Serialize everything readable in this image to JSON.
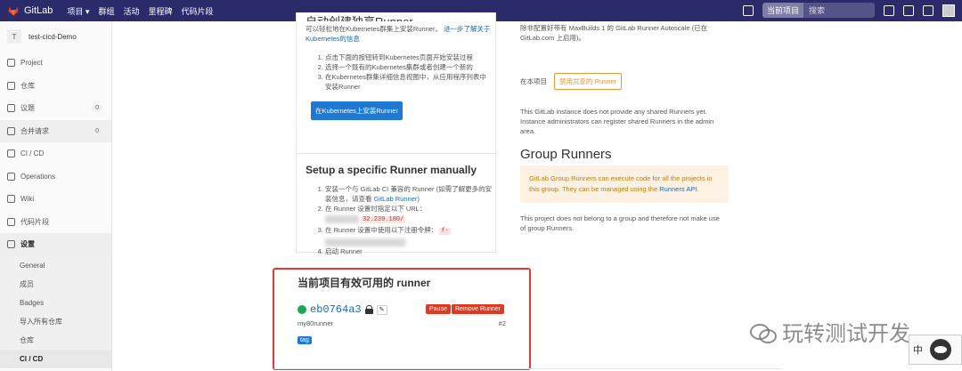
{
  "topbar": {
    "logo_text": "GitLab",
    "nav": [
      "项目 ▾",
      "群组",
      "活动",
      "里程碑",
      "代码片段"
    ],
    "search_scope": "当前项目",
    "search_placeholder": "搜索",
    "bg_color": "#2b2a6b"
  },
  "sidebar": {
    "project_initial": "T",
    "project_name": "test-cicd-Demo",
    "items": [
      {
        "label": "Project",
        "icon": "home-icon"
      },
      {
        "label": "仓库",
        "icon": "book-icon"
      },
      {
        "label": "议题",
        "icon": "issues-icon",
        "count": "0"
      },
      {
        "label": "合并请求",
        "icon": "merge-request-icon",
        "count": "0"
      },
      {
        "label": "CI / CD",
        "icon": "rocket-icon"
      },
      {
        "label": "Operations",
        "icon": "cloud-icon"
      },
      {
        "label": "Wiki",
        "icon": "book-open-icon"
      },
      {
        "label": "代码片段",
        "icon": "scissors-icon"
      }
    ],
    "settings_label": "设置",
    "settings_subitems": [
      "General",
      "成员",
      "Badges",
      "导入所有仓库",
      "仓库",
      "CI / CD"
    ]
  },
  "specific": {
    "heading": "自动创建独享Runner",
    "intro": "可以轻松地在Kubernetes群集上安装Runner。",
    "intro_link": "进一步了解关于Kubernetes的信息",
    "steps": [
      "点击下面的按钮转到Kubernetes页面开始安装过程",
      "选择一个既有的Kubernetes集群或者创建一个新的",
      "在Kubernetes群集详细信息视图中，从应用程序列表中安装Runner"
    ],
    "install_button": "在Kubernetes上安装Runner",
    "manual_heading": "Setup a specific Runner manually",
    "manual_step1": "安装一个与 GitLab CI 兼容的 Runner (如需了解更多的安装信息，请查看 ",
    "manual_step1_link": "GitLab Runner",
    "manual_step1_end": ")",
    "manual_step2": "在 Runner 设置时指定以下 URL：",
    "manual_url": "32.239.180/",
    "manual_step3": "在 Runner 设置中使用以下注册令牌：",
    "manual_token": "f-",
    "manual_step4": "启动 Runner"
  },
  "shared": {
    "text_top": "除非配置好带有 MaxBuilds 1 的 GitLab Runner Autoscale (已在 GitLab.com 上启用)。",
    "this_project_label": "在本项目",
    "disable_button": "禁用共享的 Runner",
    "no_shared": "This GitLab instance does not provide any shared Runners yet. Instance administrators can register shared Runners in the admin area."
  },
  "group": {
    "heading": "Group Runners",
    "warning_text": "GitLab Group Runners can execute code for all the projects in this group. They can be managed using the ",
    "warning_link": "Runners API",
    "warning_end": ".",
    "note": "This project does not belong to a group and therefore not make use of group Runners."
  },
  "active_runners": {
    "heading": "当前项目有效可用的 runner",
    "runner_id": "eb0764a3",
    "pause_label": "Pause",
    "remove_label": "Remove Runner",
    "description": "my80runner",
    "number": "#2",
    "tag": "tag",
    "status_color": "#1aaa55"
  },
  "watermark": {
    "text": "玩转测试开发"
  },
  "ime": {
    "label": "中"
  }
}
